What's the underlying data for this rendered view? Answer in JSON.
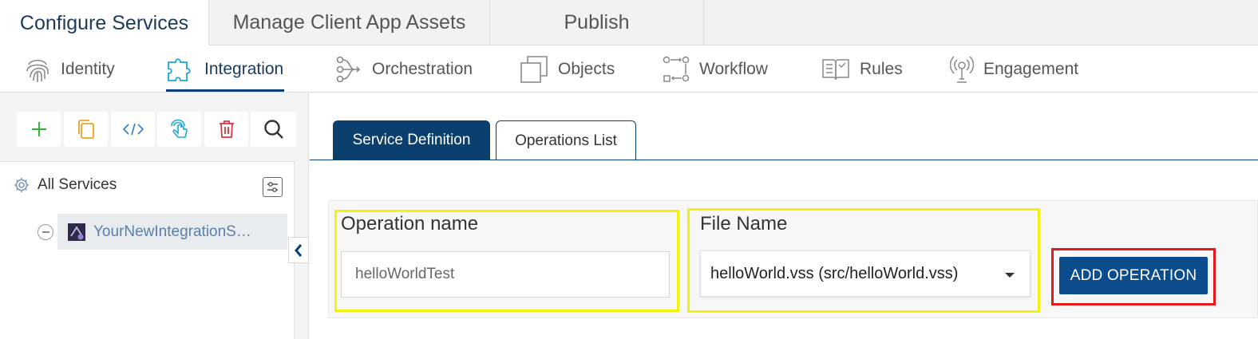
{
  "top_tabs": [
    {
      "label": "Configure Services",
      "active": true
    },
    {
      "label": "Manage Client App Assets",
      "active": false
    },
    {
      "label": "Publish",
      "active": false
    }
  ],
  "sub_nav": [
    {
      "label": "Identity",
      "icon": "fingerprint-icon"
    },
    {
      "label": "Integration",
      "icon": "puzzle-icon",
      "active": true
    },
    {
      "label": "Orchestration",
      "icon": "orchestration-icon"
    },
    {
      "label": "Objects",
      "icon": "objects-icon"
    },
    {
      "label": "Workflow",
      "icon": "workflow-icon"
    },
    {
      "label": "Rules",
      "icon": "rules-book-icon"
    },
    {
      "label": "Engagement",
      "icon": "engagement-icon"
    }
  ],
  "toolbar": {
    "buttons": [
      "add-icon",
      "copy-icon",
      "code-icon",
      "touch-icon",
      "delete-icon",
      "search-icon"
    ]
  },
  "tree": {
    "root_label": "All Services",
    "items": [
      {
        "label": "YourNewIntegrationS…"
      }
    ]
  },
  "service_tabs": [
    {
      "label": "Service Definition",
      "active": false
    },
    {
      "label": "Operations List",
      "active": true
    }
  ],
  "form": {
    "operation_name_label": "Operation name",
    "operation_name_value": "helloWorldTest",
    "file_name_label": "File Name",
    "file_name_value": "helloWorld.vss (src/helloWorld.vss)",
    "add_button_label": "ADD OPERATION"
  },
  "colors": {
    "primary": "#0b3f6e",
    "button": "#0b4c8c",
    "highlight_yellow": "#f2f20a",
    "highlight_red": "#e41b1b",
    "add_green": "#3cb043",
    "copy_orange": "#f0a020",
    "delete_red": "#d9363e"
  }
}
